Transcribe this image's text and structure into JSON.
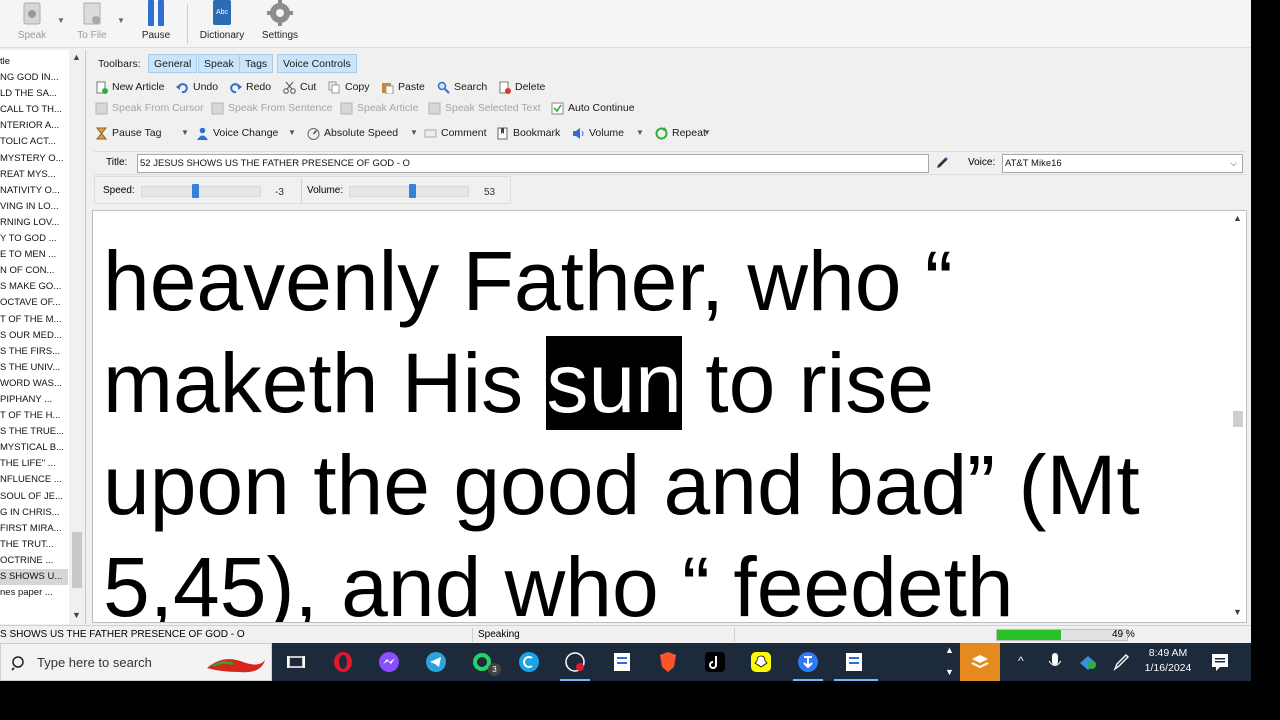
{
  "toolbar": {
    "speak": "Speak",
    "to_file": "To File",
    "pause": "Pause",
    "dictionary": "Dictionary",
    "settings": "Settings"
  },
  "sidebar": {
    "header": "tle",
    "items": [
      "NG GOD IN...",
      "LD THE SA...",
      "CALL TO TH...",
      "NTERIOR A...",
      "TOLIC ACT...",
      "MYSTERY O...",
      "REAT MYS...",
      "NATIVITY O...",
      "VING IN LO...",
      "RNING LOV...",
      "Y TO GOD ...",
      "E TO MEN ...",
      "N OF CON...",
      "S MAKE GO...",
      "OCTAVE OF...",
      "T OF THE M...",
      "S OUR MED...",
      "S THE FIRS...",
      "S THE UNIV...",
      "WORD WAS...",
      "PIPHANY ...",
      "T OF THE H...",
      "S THE TRUE...",
      "MYSTICAL B...",
      "THE LIFE\" ...",
      "NFLUENCE ...",
      "SOUL OF JE...",
      "G IN CHRIS...",
      "FIRST MIRA...",
      "THE TRUT...",
      "OCTRINE ...",
      "S SHOWS U...",
      "nes paper ..."
    ],
    "selected_index": 31
  },
  "toolbars": {
    "label": "Toolbars:",
    "tabs": [
      "General",
      "Speak",
      "Tags",
      "Voice Controls"
    ],
    "row1": [
      "New Article",
      "Undo",
      "Redo",
      "Cut",
      "Copy",
      "Paste",
      "Search",
      "Delete"
    ],
    "row2": [
      "Speak From Cursor",
      "Speak From Sentence",
      "Speak Article",
      "Speak Selected Text",
      "Auto Continue"
    ],
    "row3": [
      "Pause Tag",
      "Voice Change",
      "Absolute Speed",
      "Comment",
      "Bookmark",
      "Volume",
      "Repeat"
    ]
  },
  "title_field": {
    "label": "Title:",
    "value": "52 JESUS SHOWS US THE FATHER PRESENCE OF GOD - O"
  },
  "voice_field": {
    "label": "Voice:",
    "value": "AT&T Mike16"
  },
  "speed": {
    "label": "Speed:",
    "value": "-3",
    "fraction": 0.45
  },
  "volume": {
    "label": "Volume:",
    "value": "53",
    "fraction": 0.53
  },
  "reader": {
    "line0": "",
    "line1": "heavenly Father, who “",
    "line2_before": "maketh His ",
    "line2_highlight": "sun",
    "line2_after": " to rise",
    "line3": "upon the good and bad” (Mt",
    "line4": "5,45), and who “ feedeth"
  },
  "status": {
    "title": "S SHOWS US THE FATHER PRESENCE OF GOD - O",
    "state": "Speaking",
    "progress_percent": 49,
    "progress_text": "49 %"
  },
  "taskbar": {
    "search_placeholder": "Type here to search",
    "time": "8:49 AM",
    "date": "1/16/2024",
    "telegram_badge": "3"
  },
  "colors": {
    "accent": "#3a7fd6",
    "tab_bg": "#cce4f7",
    "progress": "#29c329",
    "taskbar": "#1c2a3c"
  }
}
